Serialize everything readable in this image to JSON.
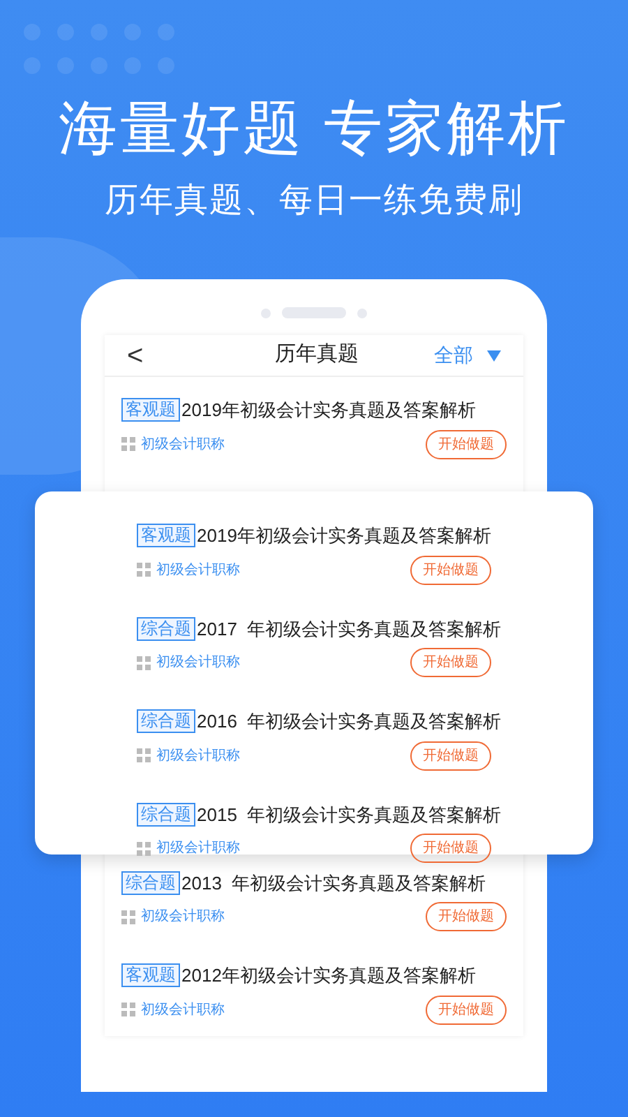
{
  "headline": "海量好题 专家解析",
  "subheadline": "历年真题、每日一练免费刷",
  "header": {
    "back": "<",
    "title": "历年真题",
    "filter": "全部"
  },
  "list_above_popup": [
    {
      "tag": "客观题",
      "title": "2019年初级会计实务真题及答案解析",
      "category": "初级会计职称",
      "action": "开始做题"
    }
  ],
  "list_below_popup": [
    {
      "tag": "综合题",
      "title": "2013  年初级会计实务真题及答案解析",
      "category": "初级会计职称",
      "action": "开始做题"
    },
    {
      "tag": "客观题",
      "title": "2012年初级会计实务真题及答案解析",
      "category": "初级会计职称",
      "action": "开始做题"
    }
  ],
  "popup": [
    {
      "tag": "客观题",
      "title": "2019年初级会计实务真题及答案解析",
      "category": "初级会计职称",
      "action": "开始做题"
    },
    {
      "tag": "综合题",
      "title": "2017  年初级会计实务真题及答案解析",
      "category": "初级会计职称",
      "action": "开始做题"
    },
    {
      "tag": "综合题",
      "title": "2016  年初级会计实务真题及答案解析",
      "category": "初级会计职称",
      "action": "开始做题"
    },
    {
      "tag": "综合题",
      "title": "2015  年初级会计实务真题及答案解析",
      "category": "初级会计职称",
      "action": "开始做题"
    }
  ]
}
